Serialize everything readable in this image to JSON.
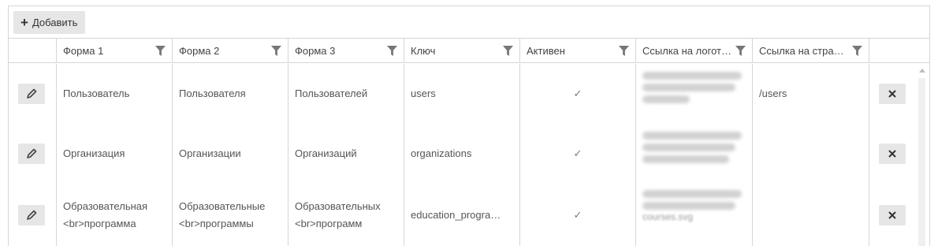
{
  "toolbar": {
    "add_label": "Добавить"
  },
  "columns": {
    "form1": "Форма 1",
    "form2": "Форма 2",
    "form3": "Форма 3",
    "key": "Ключ",
    "active": "Активен",
    "logo": "Ссылка на логот…",
    "page": "Ссылка на стран…"
  },
  "rows": [
    {
      "form1": "Пользователь",
      "form2": "Пользователя",
      "form3": "Пользователей",
      "key": "users",
      "active": "✓",
      "page": "/users"
    },
    {
      "form1": "Организация",
      "form2": "Организации",
      "form3": "Организаций",
      "key": "organizations",
      "active": "✓",
      "page": ""
    },
    {
      "form1": "Образовательная <br>программа",
      "form2": "Образовательные <br>программы",
      "form3": "Образовательных <br>программ",
      "key": "education_progra…",
      "active": "✓",
      "page": "",
      "logo_tail": "courses.svg"
    }
  ],
  "icons": {
    "add": "plus-icon",
    "filter": "filter-icon",
    "edit": "pencil-icon",
    "delete": "close-icon"
  }
}
